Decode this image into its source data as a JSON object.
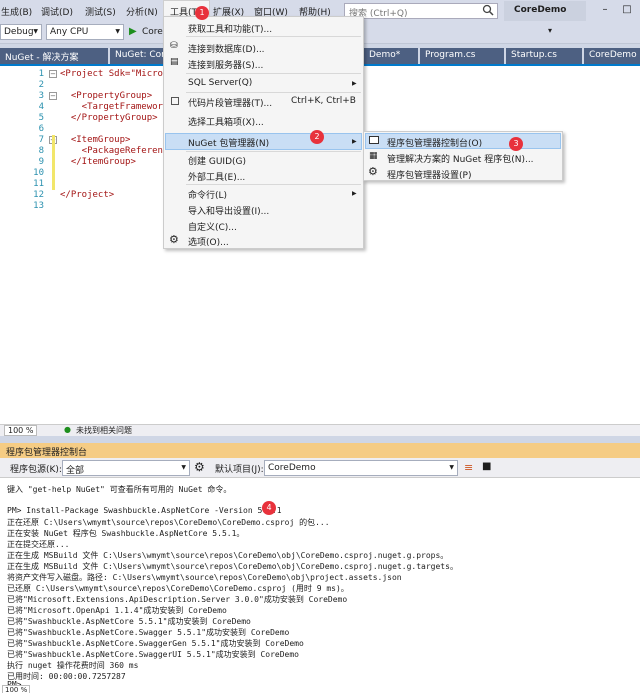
{
  "menubar": {
    "items": [
      "生成(B)",
      "调试(D)",
      "测试(S)",
      "分析(N)",
      "工具(T)",
      "扩展(X)",
      "窗口(W)",
      "帮助(H)"
    ],
    "search_placeholder": "搜索 (Ctrl+Q)",
    "project_name": "CoreDemo"
  },
  "toolbar": {
    "config": "Debug",
    "platform": "Any CPU",
    "run_label": "Core"
  },
  "tabs": [
    "NuGet - 解决方案",
    "NuGet: Core",
    "Demo*",
    "Program.cs",
    "Startup.cs",
    "CoreDemo"
  ],
  "code": {
    "line_numbers": [
      "1",
      "2",
      "3",
      "4",
      "5",
      "6",
      "7",
      "8",
      "9",
      "10",
      "11",
      "12",
      "13"
    ],
    "lines": [
      "<Project Sdk=\"Microsof",
      "",
      "  <PropertyGroup>",
      "    <TargetFramework>n",
      "  </PropertyGroup>",
      "",
      "  <ItemGroup>",
      "    <PackageReference",
      "  </ItemGroup>",
      "",
      "",
      "</Project>",
      ""
    ]
  },
  "tools_menu": {
    "items": [
      {
        "label": "获取工具和功能(T)...",
        "shortcut": ""
      },
      {
        "label": "连接到数据库(D)...",
        "shortcut": ""
      },
      {
        "label": "连接到服务器(S)...",
        "shortcut": ""
      },
      {
        "label": "SQL Server(Q)",
        "shortcut": ""
      },
      {
        "label": "代码片段管理器(T)...",
        "shortcut": "Ctrl+K, Ctrl+B"
      },
      {
        "label": "选择工具箱项(X)...",
        "shortcut": ""
      },
      {
        "label": "NuGet 包管理器(N)",
        "shortcut": ""
      },
      {
        "label": "创建 GUID(G)",
        "shortcut": ""
      },
      {
        "label": "外部工具(E)...",
        "shortcut": ""
      },
      {
        "label": "命令行(L)",
        "shortcut": ""
      },
      {
        "label": "导入和导出设置(I)...",
        "shortcut": ""
      },
      {
        "label": "自定义(C)...",
        "shortcut": ""
      },
      {
        "label": "选项(O)...",
        "shortcut": ""
      }
    ]
  },
  "nuget_submenu": {
    "items": [
      "程序包管理器控制台(O)",
      "管理解决方案的 NuGet 程序包(N)...",
      "程序包管理器设置(P)"
    ]
  },
  "badges": [
    "1",
    "2",
    "3",
    "4"
  ],
  "editor_status": {
    "zoom": "100 %",
    "issues": "未找到相关问题"
  },
  "pmc": {
    "title": "程序包管理器控制台",
    "source_label": "程序包源(K):",
    "source_value": "全部",
    "project_label": "默认项目(J):",
    "project_value": "CoreDemo"
  },
  "console": {
    "lines": [
      "键入 \"get-help NuGet\" 可查看所有可用的 NuGet 命令。",
      "",
      "PM> Install-Package Swashbuckle.AspNetCore -Version 5.5.1",
      "正在还原 C:\\Users\\wmymt\\source\\repos\\CoreDemo\\CoreDemo.csproj 的包...",
      "正在安装 NuGet 程序包 Swashbuckle.AspNetCore 5.5.1。",
      "正在提交还原...",
      "正在生成 MSBuild 文件 C:\\Users\\wmymt\\source\\repos\\CoreDemo\\obj\\CoreDemo.csproj.nuget.g.props。",
      "正在生成 MSBuild 文件 C:\\Users\\wmymt\\source\\repos\\CoreDemo\\obj\\CoreDemo.csproj.nuget.g.targets。",
      "将资产文件写入磁盘。路径: C:\\Users\\wmymt\\source\\repos\\CoreDemo\\obj\\project.assets.json",
      "已还原 C:\\Users\\wmymt\\source\\repos\\CoreDemo\\CoreDemo.csproj (用时 9 ms)。",
      "已将\"Microsoft.Extensions.ApiDescription.Server 3.0.0\"成功安装到 CoreDemo",
      "已将\"Microsoft.OpenApi 1.1.4\"成功安装到 CoreDemo",
      "已将\"Swashbuckle.AspNetCore 5.5.1\"成功安装到 CoreDemo",
      "已将\"Swashbuckle.AspNetCore.Swagger 5.5.1\"成功安装到 CoreDemo",
      "已将\"Swashbuckle.AspNetCore.SwaggerGen 5.5.1\"成功安装到 CoreDemo",
      "已将\"Swashbuckle.AspNetCore.SwaggerUI 5.5.1\"成功安装到 CoreDemo",
      "执行 nuget 操作花费时间 360 ms",
      "已用时间: 00:00:00.7257287",
      "PM>"
    ],
    "zoom": "100 %"
  },
  "colors": {
    "accent": "#007acc",
    "badge": "#e8323c",
    "pmc_title_bg": "#f5cc84",
    "tab_bg": "#4d6082"
  }
}
